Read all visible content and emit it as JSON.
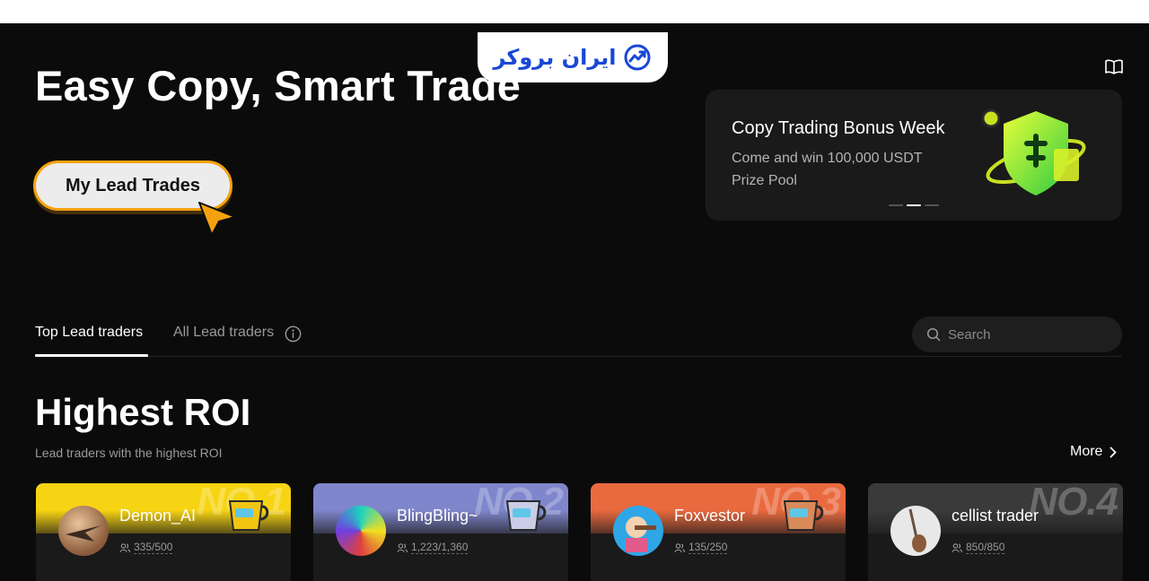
{
  "logo": {
    "text": "ایران بروکر"
  },
  "hero": {
    "title": "Easy Copy, Smart Trade",
    "lead_button": "My Lead Trades"
  },
  "promo": {
    "title": "Copy Trading Bonus Week",
    "text": "Come and win 100,000 USDT Prize Pool",
    "slides": 3,
    "active_slide": 2
  },
  "tabs": {
    "top": "Top Lead traders",
    "all": "All Lead traders"
  },
  "search": {
    "placeholder": "Search"
  },
  "section": {
    "title": "Highest ROI",
    "subtitle": "Lead traders with the highest ROI",
    "more": "More"
  },
  "traders": [
    {
      "name": "Demon_AI",
      "followers": "335/500",
      "rank": "NO.1",
      "color": "#f7d413",
      "rank_color": "#ffffff"
    },
    {
      "name": "BlingBling~",
      "followers": "1,223/1,360",
      "rank": "NO.2",
      "color": "#7f86cc",
      "rank_color": "#ffffff"
    },
    {
      "name": "Foxvestor",
      "followers": "135/250",
      "rank": "NO.3",
      "color": "#ea6a3f",
      "rank_color": "#ffffff"
    },
    {
      "name": "cellist trader",
      "followers": "850/850",
      "rank": "NO.4",
      "color": "#3a3a3a",
      "rank_color": "#ffffff"
    }
  ],
  "colors": {
    "accent": "#f5a10f",
    "brand": "#1947d6",
    "background": "#0b0b0b"
  }
}
